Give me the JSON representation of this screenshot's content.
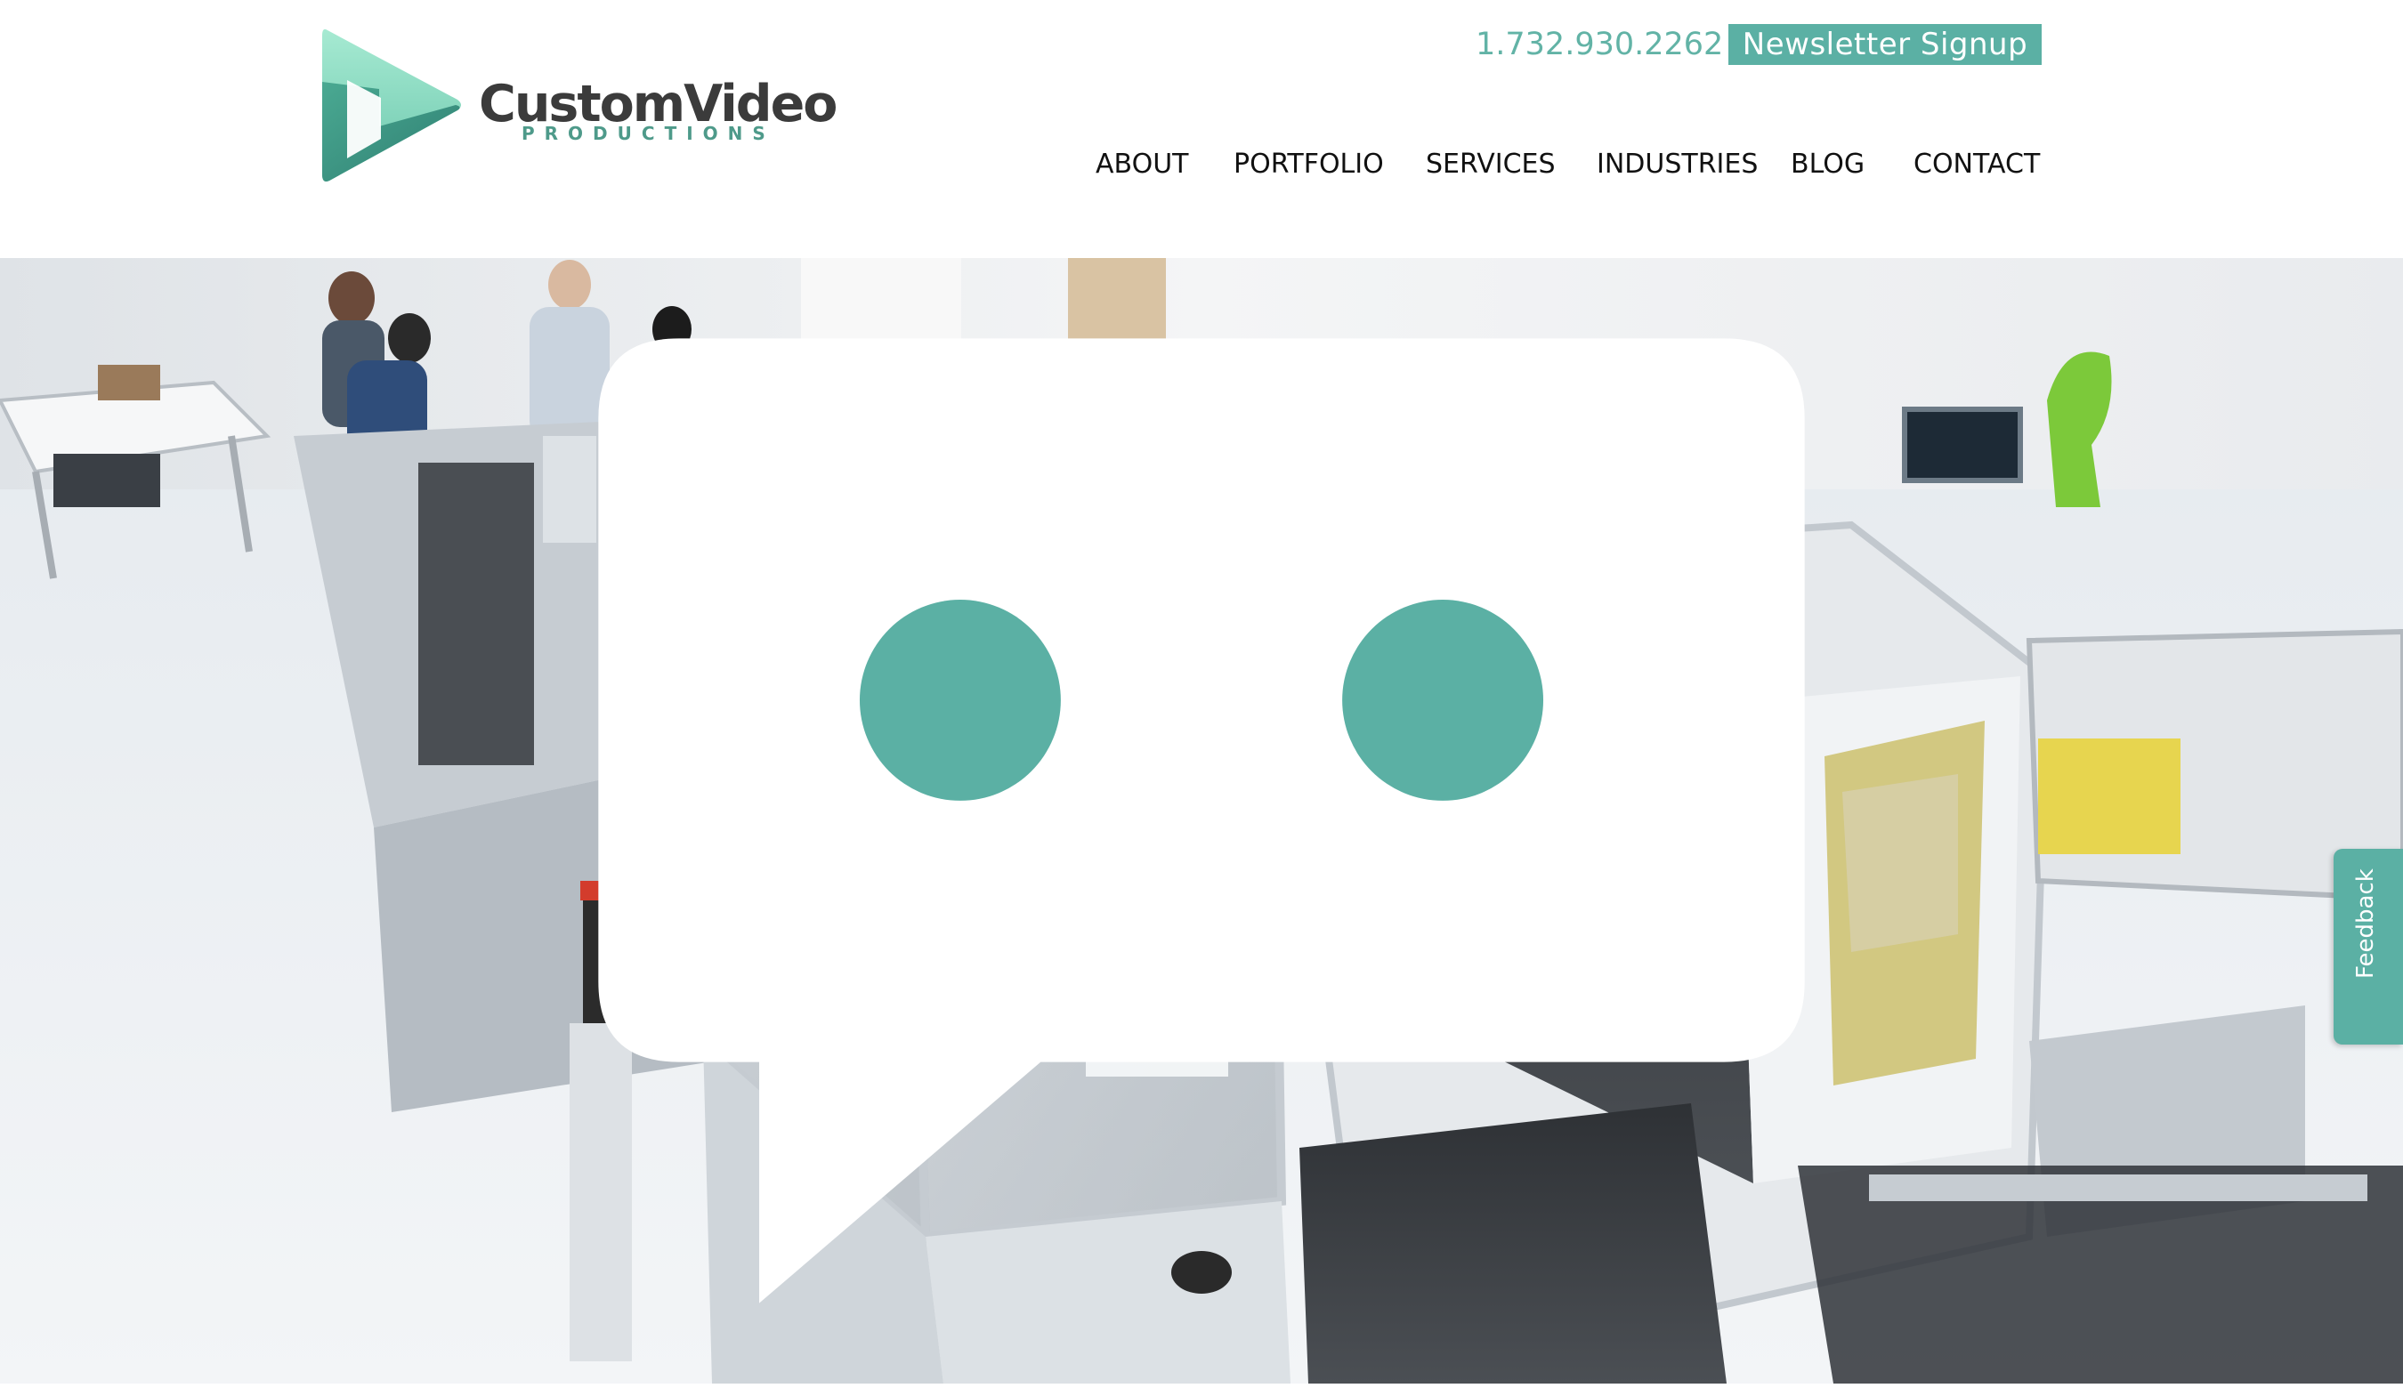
{
  "header": {
    "logo": {
      "word": "CustomVideo",
      "sub": "PRODUCTIONS",
      "colors": {
        "light": "#8fdcc4",
        "mid": "#5bb89f",
        "dark": "#3d8a7e"
      }
    },
    "phone": "1.732.930.2262",
    "newsletter_label": "Newsletter Signup",
    "nav": [
      {
        "label": "ABOUT"
      },
      {
        "label": "PORTFOLIO"
      },
      {
        "label": "SERVICES"
      },
      {
        "label": "INDUSTRIES"
      },
      {
        "label": "BLOG"
      },
      {
        "label": "CONTACT"
      }
    ]
  },
  "hero": {
    "image": "industrial-robotic-assembly-line-photo"
  },
  "feedback": {
    "label": "Feedback",
    "icon": "chat-icon"
  },
  "colors": {
    "accent": "#5bb0a4",
    "phone": "#62b3a6",
    "nav_text": "#111111"
  }
}
